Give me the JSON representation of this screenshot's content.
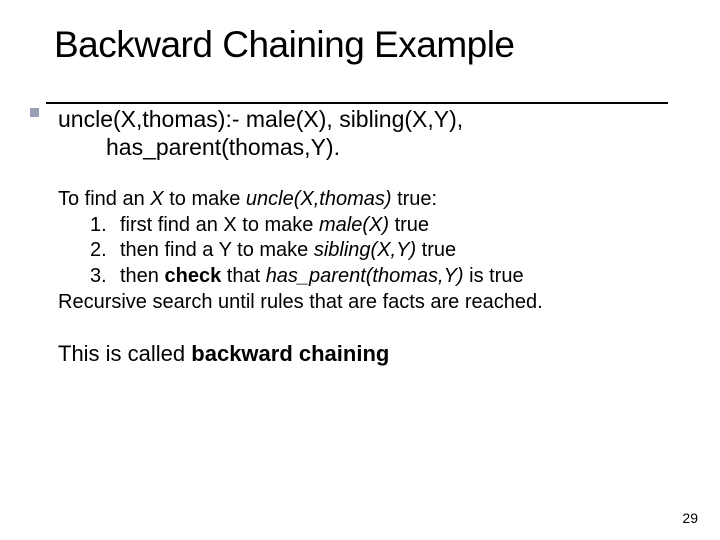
{
  "title": "Backward Chaining Example",
  "clause": {
    "line1": "uncle(X,thomas):- male(X), sibling(X,Y),",
    "line2": "has_parent(thomas,Y)."
  },
  "body": {
    "intro_pre": "To find an ",
    "intro_x": "X ",
    "intro_mid": " to make ",
    "intro_call": "uncle(X,thomas) ",
    "intro_post": "true:",
    "items": [
      {
        "num": "1.",
        "pre": "first find an X to make ",
        "call": "male(X) ",
        "post": "true"
      },
      {
        "num": "2.",
        "pre": "then find a Y to make ",
        "call": "sibling(X,Y) ",
        "post": "true"
      },
      {
        "num": "3.",
        "pre": "then ",
        "strong": "check",
        "mid": " that ",
        "call": "has_parent(thomas,Y) ",
        "post": "is true"
      }
    ],
    "recursive": "Recursive search until rules that are facts are reached."
  },
  "closing": {
    "pre": "This is called ",
    "strong": "backward chaining"
  },
  "pagenum": "29"
}
